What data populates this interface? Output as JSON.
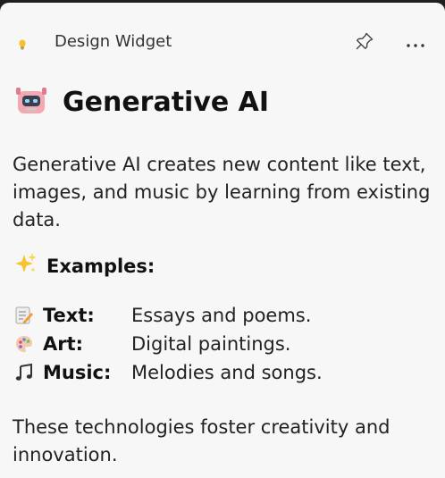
{
  "header": {
    "app_icon": "lightbulb-icon",
    "title": "Design Widget",
    "pin_icon": "pin-icon",
    "more_icon": "more-horizontal-icon"
  },
  "content": {
    "heading_icon": "robot-emoji-icon",
    "heading": "Generative AI",
    "intro": "Generative AI creates new content like text, images, and music by learning from existing data.",
    "examples_icon": "sparkles-emoji-icon",
    "examples_label": "Examples:",
    "examples": [
      {
        "icon": "memo-emoji-icon",
        "name": "Text:",
        "desc": "Essays and poems."
      },
      {
        "icon": "palette-emoji-icon",
        "name": "Art:",
        "desc": "Digital paintings."
      },
      {
        "icon": "music-notes-emoji-icon",
        "name": "Music:",
        "desc": "Melodies and songs."
      }
    ],
    "outro": "These technologies foster creativity and innovation."
  },
  "colors": {
    "window_background": "#f7f7f7",
    "frame_background": "#1f1f1f",
    "text": "#222222"
  }
}
